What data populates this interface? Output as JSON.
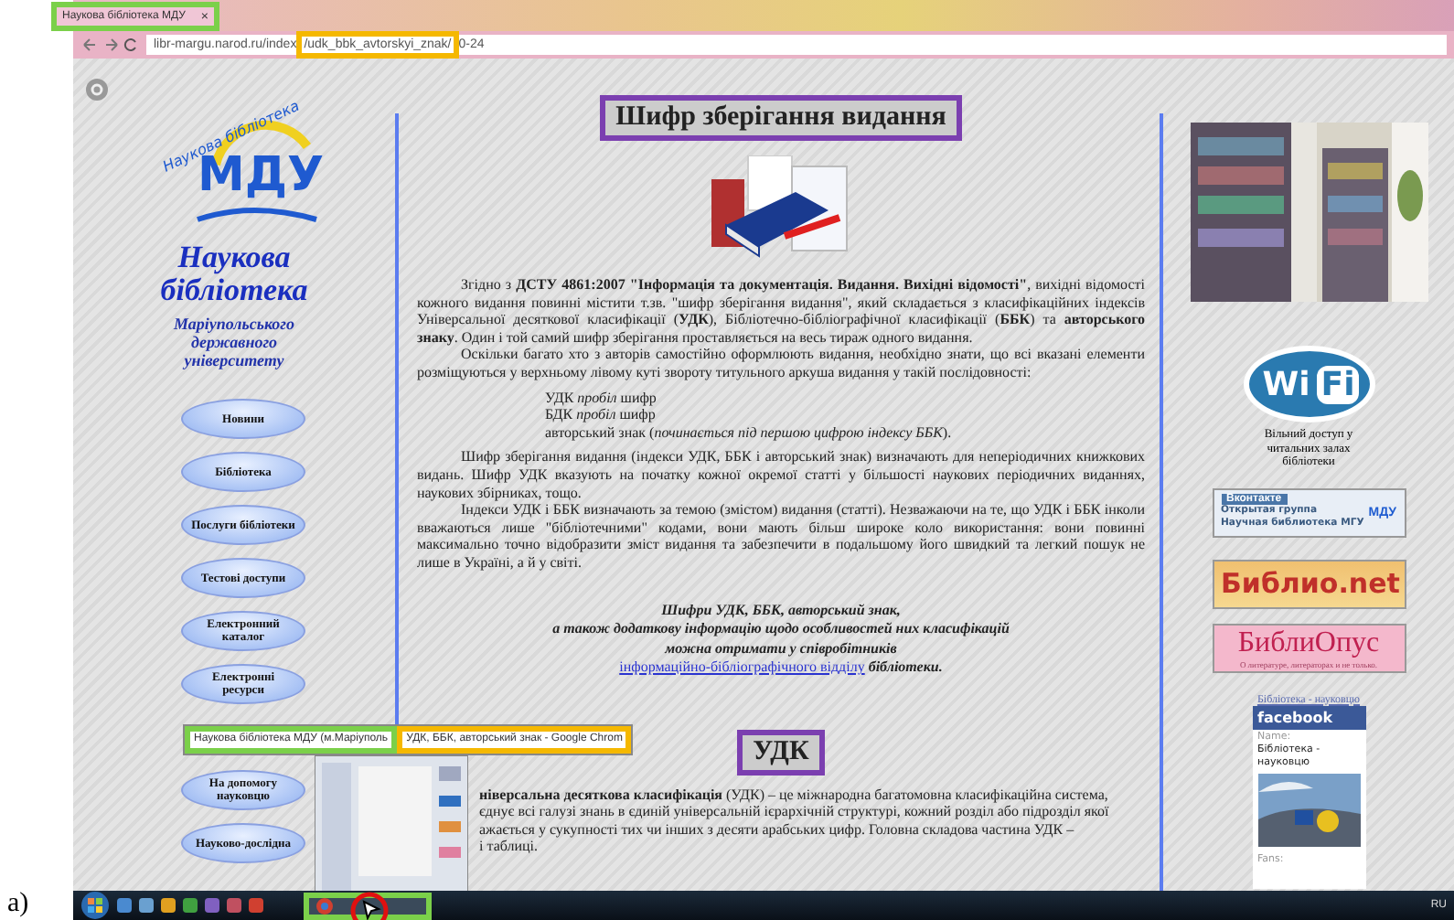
{
  "figure_label": "a)",
  "browser": {
    "tab": {
      "title": "Наукова бібліотека МДУ",
      "close": "×"
    },
    "address": {
      "host": "libr-margu.narod.ru/index",
      "highlight": "/udk_bbk_avtorskyi_znak/",
      "rest": "0-24"
    }
  },
  "sidebar": {
    "logo_arc": "Наукова бібліотека",
    "logo_mark": "МДУ",
    "title": "Наукова бібліотека",
    "subtitle": "Маріупольського державного університету",
    "nav": [
      {
        "label": "Новини"
      },
      {
        "label": "Бібліотека"
      },
      {
        "label": "Послуги бібліотеки"
      },
      {
        "label": "Тестові доступи"
      },
      {
        "label": "Електронний каталог"
      },
      {
        "label": "Електронні ресурси"
      },
      {
        "label": "На допомогу науковцю"
      },
      {
        "label": "Науково-дослідна"
      }
    ]
  },
  "content": {
    "title": "Шифр зберігання видання",
    "paragraphs": [
      "Згідно з **ДСТУ 4861:2007 \"Інформація та документація. Видання. Вихідні відомості\"**, вихідні відомості кожного видання повинні містити т.зв. \"шифр зберігання видання\", який складається з класифікаційних індексів Універсальної десяткової класифікації (**УДК**), Бібліотечно-бібліографічної класифікації (**ББК**) та **авторського знаку**. Один і той самий шифр зберігання проставляється на весь тираж одного видання.",
      "Оскільки багато хто з авторів самостійно оформлюють видання, необхідно знати, що всі вказані елементи розміщуються у верхньому лівому куті звороту титульного аркуша видання у такій послідовності:"
    ],
    "sequence": [
      "УДК *пробіл* шифр",
      "БДК *пробіл* шифр",
      "авторський знак (*починається під першою цифрою індексу ББК*)."
    ],
    "paragraphs_2": [
      "Шифр зберігання видання (індекси УДК, ББК і авторський знак) визначають для неперіодичних книжкових видань. Шифр УДК вказують на початку кожної окремої статті у більшості наукових періодичних виданнях, наукових збірниках, тощо.",
      "Індекси УДК і ББК визначають за темою (змістом) видання (статті). Незважаючи на те, що УДК і ББК інколи вважаються лише \"бібліотечними\" кодами, вони мають більш широке коло використання: вони повинні максимально точно відобразити зміст видання та забезпечити в подальшому його швидкий та легкий пошук не лише в Україні, а й у світі."
    ],
    "note_lines": [
      "Шифри УДК, ББК, авторський знак,",
      "а також додаткову інформацію щодо особливостей них класифікацій",
      "можна отримати у співробітників"
    ],
    "note_link": "інформаційно-бібліографічного відділу",
    "note_tail": "бібліотеки.",
    "section_title": "УДК",
    "section_lines": [
      "**ніверсальна десяткова класифікація** (УДК) – це міжнародна багатомовна класифікаційна система,",
      "єднує всі галузі знань в єдиній універсальній ієрархічній структурі, кожний розділ або підрозділ якої",
      "ажається у сукупності тих чи інших з десяти арабських цифр. Головна складова частина УДК –",
      "і таблиці."
    ]
  },
  "right": {
    "wifi": {
      "wi": "Wi",
      "fi": "Fi",
      "caption": "Вільний доступ у читальних залах бібліотеки"
    },
    "vk": {
      "brand": "Вконтакте",
      "lines": [
        "Открытая группа",
        "Научная библиотека МГУ"
      ],
      "logo": "МДУ"
    },
    "biblionet": "Библио.net",
    "biblioopus": {
      "title": "БиблиОпус",
      "tagline": "О литературе, литераторах и не только."
    },
    "facebook": {
      "caption": "Бібліотека - науковцю",
      "brand": "facebook",
      "name_label": "Name:",
      "name": "Бібліотека - науковцю",
      "fans_label": "Fans:"
    }
  },
  "tooltip": {
    "title": "Наукова бібліотека МДУ (м.Маріуполь",
    "window": "УДК, ББК, авторський знак - Google Chrom"
  },
  "taskbar": {
    "language": "RU"
  }
}
